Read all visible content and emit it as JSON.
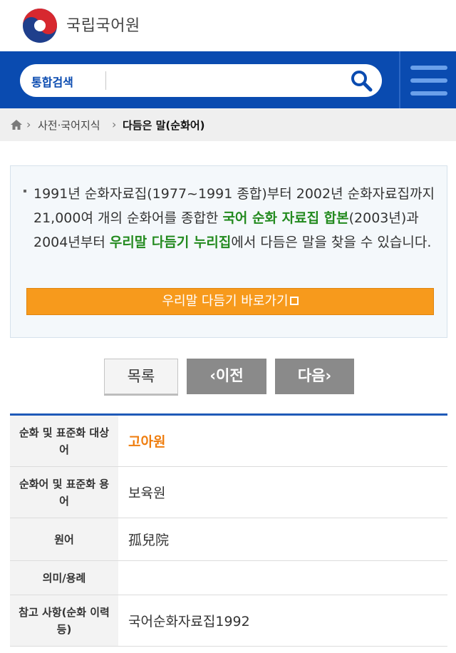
{
  "header": {
    "org_name": "국립국어원"
  },
  "search": {
    "label": "통합검색",
    "value": ""
  },
  "breadcrumb": {
    "items": [
      "사전·국어지식",
      "다듬은 말(순화어)"
    ]
  },
  "info": {
    "text_parts": [
      "1991년 순화자료집(1977~1991 종합)부터 2002년 순화자료집까지 21,000여 개의 순화어를 종합한 ",
      "국어 순화 자료집 합본",
      "(2003년)과 2004년부터 ",
      "우리말 다듬기 누리집",
      "에서 다듬은 말을 찾을 수 있습니다."
    ],
    "go_button": "우리말 다듬기 바로가기"
  },
  "nav": {
    "list": "목록",
    "prev": "‹이전",
    "next": "다음›"
  },
  "table": {
    "rows": [
      {
        "label": "순화 및 표준화 대상어",
        "value": "고아원"
      },
      {
        "label": "순화어 및 표준화 용어",
        "value": "보육원"
      },
      {
        "label": "원어",
        "value": "孤兒院"
      },
      {
        "label": "의미/용례",
        "value": ""
      },
      {
        "label": "참고 사항(순화 이력 등)",
        "value": "국어순화자료집1992"
      }
    ]
  },
  "colors": {
    "brand_blue": "#0a4bb0",
    "highlight_green": "#238a1f",
    "accent_orange": "#f79a1c",
    "target_word_orange": "#ef7d0e"
  }
}
